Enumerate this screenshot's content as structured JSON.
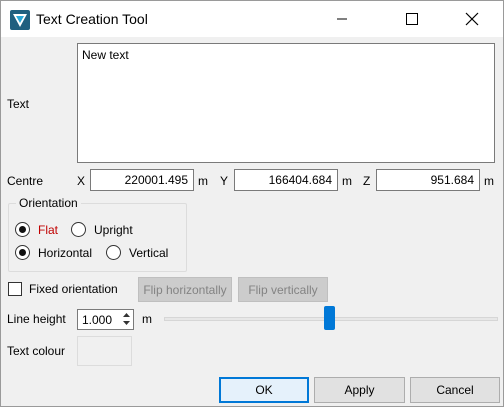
{
  "window": {
    "title": "Text Creation Tool",
    "controls": {
      "minimize": "minimize-icon",
      "maximize": "maximize-icon",
      "close": "close-icon"
    }
  },
  "text": {
    "label": "Text",
    "value": "New text"
  },
  "centre": {
    "label": "Centre",
    "x": {
      "label": "X",
      "value": "220001.495",
      "unit": "m"
    },
    "y": {
      "label": "Y",
      "value": "166404.684",
      "unit": "m"
    },
    "z": {
      "label": "Z",
      "value": "951.684",
      "unit": "m"
    }
  },
  "orientation": {
    "title": "Orientation",
    "flat": {
      "label": "Flat",
      "checked": true
    },
    "upright": {
      "label": "Upright",
      "checked": false
    },
    "horizontal": {
      "label": "Horizontal",
      "checked": true
    },
    "vertical": {
      "label": "Vertical",
      "checked": false
    }
  },
  "fixed_orientation": {
    "label": "Fixed orientation",
    "checked": false
  },
  "flip_horizontally": "Flip horizontally",
  "flip_vertically": "Flip vertically",
  "line_height": {
    "label": "Line height",
    "value": "1.000",
    "unit": "m",
    "slider_fraction": 0.5
  },
  "text_colour": {
    "label": "Text colour"
  },
  "buttons": {
    "ok": "OK",
    "apply": "Apply",
    "cancel": "Cancel"
  },
  "colors": {
    "accent": "#0078d7",
    "flat_label": "#c00000"
  }
}
